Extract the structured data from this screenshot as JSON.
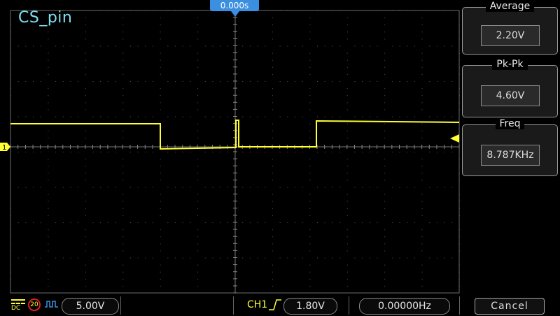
{
  "scope": {
    "channel_label": "CS_pin",
    "trigger_time": "0.000s",
    "channel_marker": "1",
    "colors": {
      "trace": "#ffff33",
      "accent": "#3a8fe0",
      "title": "#7fe0f0"
    }
  },
  "measurements": [
    {
      "title": "Average",
      "value": "2.20V"
    },
    {
      "title": "Pk-Pk",
      "value": "4.60V"
    },
    {
      "title": "Freq",
      "value": "8.787KHz"
    }
  ],
  "bottom": {
    "coupling": "DC",
    "bw_limit": "20",
    "volts_div": "5.00V",
    "trigger_source": "CH1",
    "trigger_level": "1.80V",
    "trigger_freq": "0.00000Hz",
    "cancel_label": "Cancel"
  }
}
